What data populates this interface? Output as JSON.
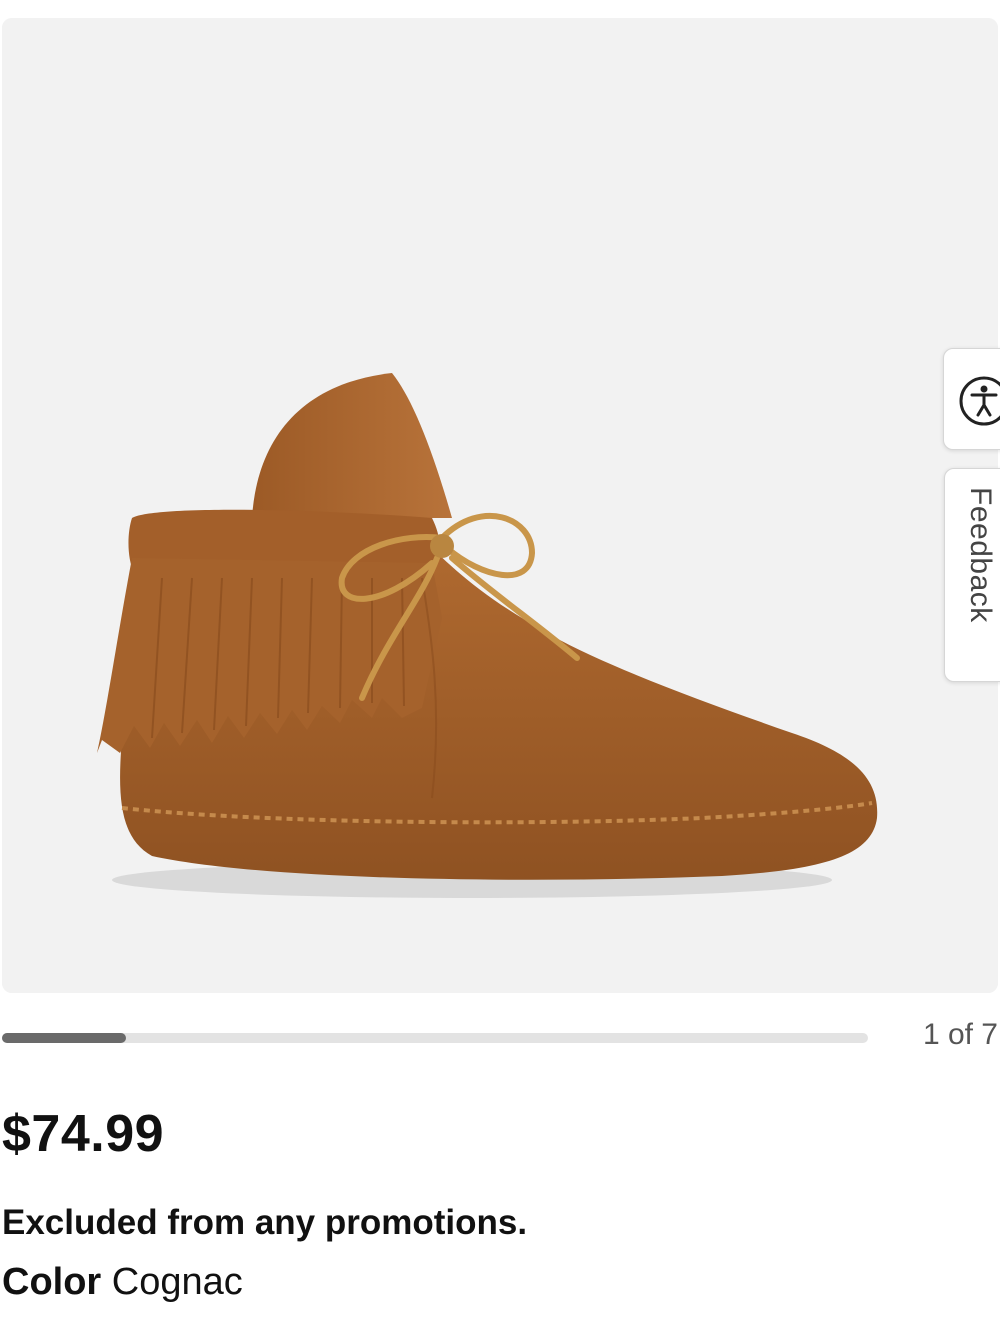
{
  "gallery": {
    "current_index": 1,
    "total": 7,
    "counter_text": "1 of 7",
    "progress_fraction": 0.143
  },
  "side_tabs": {
    "accessibility_icon": "accessibility-person-icon",
    "feedback_label": "Feedback"
  },
  "product": {
    "price": "$74.99",
    "promo_note": "Excluded from any promotions.",
    "color_label": "Color",
    "color_value": "Cognac"
  },
  "colors": {
    "shoe": "#a8642e",
    "lace": "#c9964a",
    "image_background": "#f2f2f2"
  }
}
